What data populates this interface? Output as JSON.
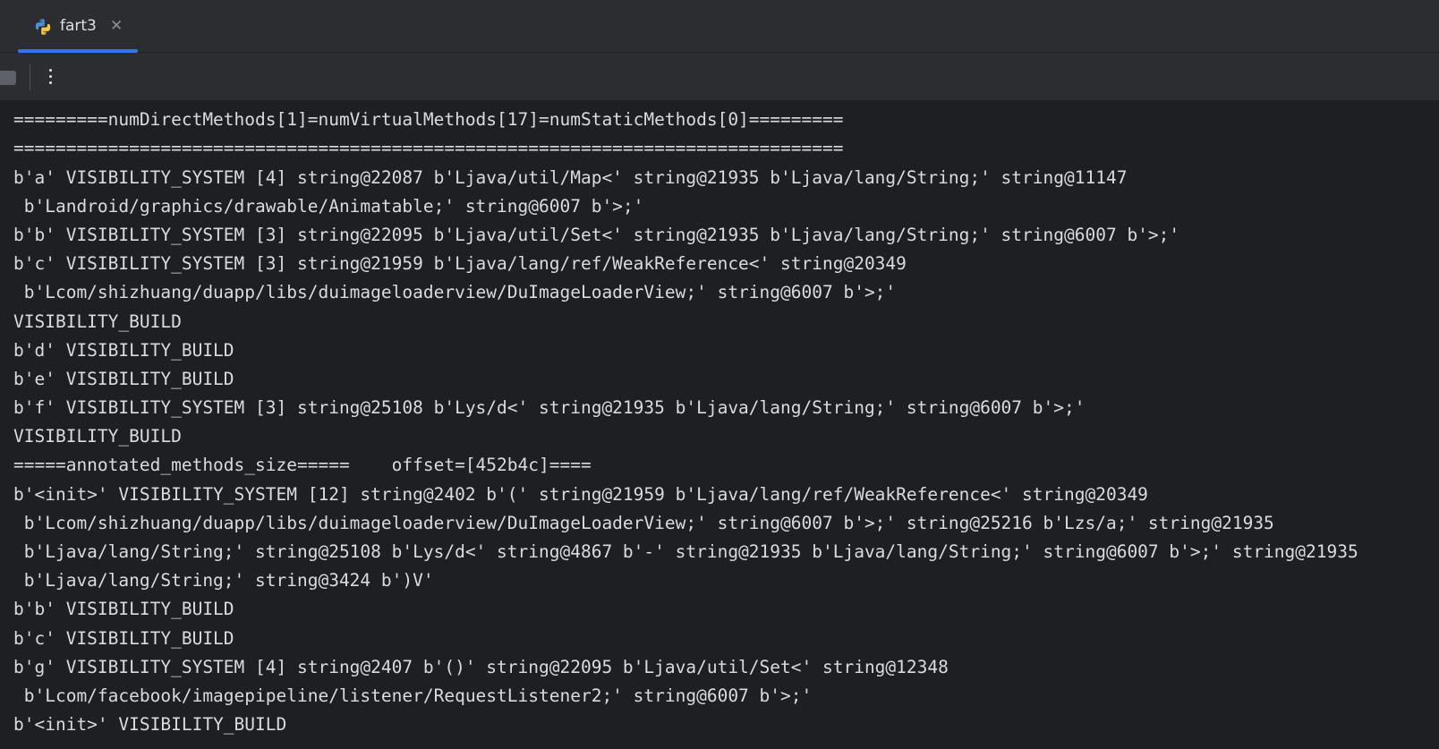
{
  "tab": {
    "title": "fart3",
    "close_glyph": "✕",
    "icon": "python-icon",
    "active_color": "#3574f0"
  },
  "toolbar": {
    "stop_icon": "stop-icon",
    "more_icon": "more-vertical-icon"
  },
  "console": {
    "lines": [
      "=========numDirectMethods[1]=numVirtualMethods[17]=numStaticMethods[0]=========",
      "===============================================================================",
      "b'a' VISIBILITY_SYSTEM [4] string@22087 b'Ljava/util/Map<' string@21935 b'Ljava/lang/String;' string@11147",
      " b'Landroid/graphics/drawable/Animatable;' string@6007 b'>;'",
      "b'b' VISIBILITY_SYSTEM [3] string@22095 b'Ljava/util/Set<' string@21935 b'Ljava/lang/String;' string@6007 b'>;'",
      "b'c' VISIBILITY_SYSTEM [3] string@21959 b'Ljava/lang/ref/WeakReference<' string@20349",
      " b'Lcom/shizhuang/duapp/libs/duimageloaderview/DuImageLoaderView;' string@6007 b'>;'",
      "VISIBILITY_BUILD",
      "b'd' VISIBILITY_BUILD",
      "b'e' VISIBILITY_BUILD",
      "b'f' VISIBILITY_SYSTEM [3] string@25108 b'Lys/d<' string@21935 b'Ljava/lang/String;' string@6007 b'>;'",
      "VISIBILITY_BUILD",
      "=====annotated_methods_size=====    offset=[452b4c]====",
      "b'<init>' VISIBILITY_SYSTEM [12] string@2402 b'(' string@21959 b'Ljava/lang/ref/WeakReference<' string@20349",
      " b'Lcom/shizhuang/duapp/libs/duimageloaderview/DuImageLoaderView;' string@6007 b'>;' string@25216 b'Lzs/a;' string@21935",
      " b'Ljava/lang/String;' string@25108 b'Lys/d<' string@4867 b'-' string@21935 b'Ljava/lang/String;' string@6007 b'>;' string@21935",
      " b'Ljava/lang/String;' string@3424 b')V'",
      "b'b' VISIBILITY_BUILD",
      "b'c' VISIBILITY_BUILD",
      "b'g' VISIBILITY_SYSTEM [4] string@2407 b'()' string@22095 b'Ljava/util/Set<' string@12348",
      " b'Lcom/facebook/imagepipeline/listener/RequestListener2;' string@6007 b'>;'",
      "b'<init>' VISIBILITY_BUILD"
    ]
  }
}
